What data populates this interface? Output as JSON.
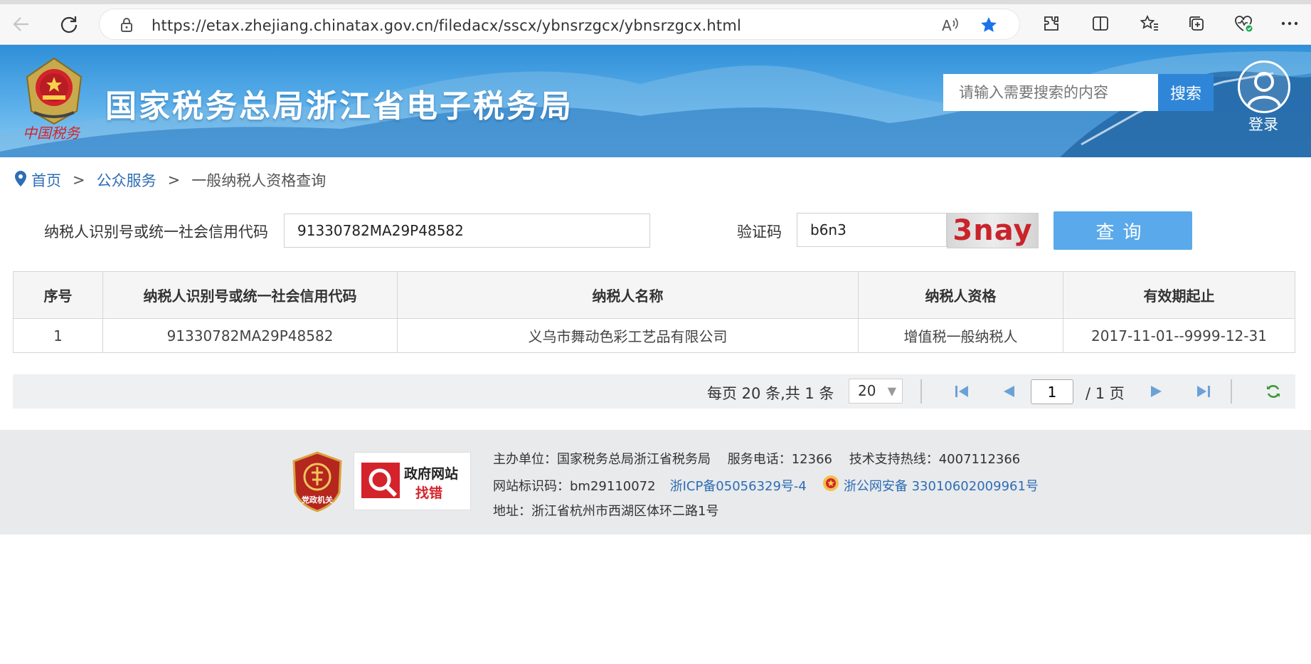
{
  "browser": {
    "url": "https://etax.zhejiang.chinatax.gov.cn/filedacx/sscx/ybnsrzgcx/ybnsrzgcx.html",
    "icons": [
      "back-icon",
      "refresh-icon",
      "lock-icon",
      "read-aloud-icon",
      "favorite-star-icon",
      "extensions-icon",
      "split-screen-icon",
      "favorites-icon",
      "collections-icon",
      "browser-essentials-icon",
      "more-icon"
    ]
  },
  "header": {
    "site_title": "国家税务总局浙江省电子税务局",
    "emblem_caption": "中国税务",
    "search_placeholder": "请输入需要搜索的内容",
    "search_button": "搜索",
    "login_label": "登录"
  },
  "breadcrumb": {
    "home": "首页",
    "sep1": ">",
    "public_service": "公众服务",
    "sep2": ">",
    "current": "一般纳税人资格查询"
  },
  "form": {
    "taxpayer_id_label": "纳税人识别号或统一社会信用代码",
    "taxpayer_id_value": "91330782MA29P48582",
    "captcha_label": "验证码",
    "captcha_value": "b6n3",
    "captcha_image_text": "3nay",
    "query_button": "查询"
  },
  "table": {
    "headers": [
      "序号",
      "纳税人识别号或统一社会信用代码",
      "纳税人名称",
      "纳税人资格",
      "有效期起止"
    ],
    "rows": [
      [
        "1",
        "91330782MA29P48582",
        "义乌市舞动色彩工艺品有限公司",
        "增值税一般纳税人",
        "2017-11-01--9999-12-31"
      ]
    ]
  },
  "pagination": {
    "info": "每页 20 条,共 1 条",
    "page_size": "20",
    "current_page": "1",
    "total_pages": "/ 1 页"
  },
  "footer": {
    "sponsor": "主办单位：国家税务总局浙江省税务局",
    "service_phone": "服务电话：12366",
    "support_hotline": "技术支持热线：4007112366",
    "site_code": "网站标识码：bm29110072",
    "icp": "浙ICP备05056329号-4",
    "police_record": "浙公网安备 33010602009961号",
    "address": "地址：浙江省杭州市西湖区体环二路1号",
    "party_badge_text": "党政机关",
    "gov_badge_line1": "政府网站",
    "gov_badge_line2": "找错"
  },
  "colors": {
    "header_blue": "#2f8fd8",
    "search_button": "#2f86d8",
    "query_button": "#5aa9ea",
    "link": "#2d6db5",
    "captcha_red": "#c9232b",
    "favorite_star": "#1a73e8"
  }
}
